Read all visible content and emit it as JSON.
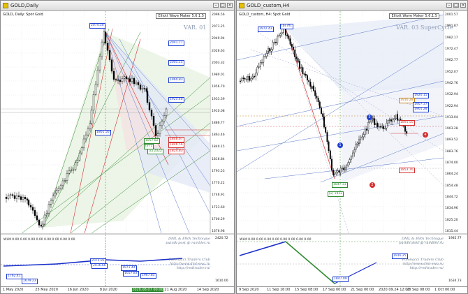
{
  "colors": {
    "blue": "#1f3fd0",
    "green": "#2e8b2e",
    "red": "#d63030",
    "gold": "#c08020",
    "grid": "#cfcfcf",
    "label_blue": "#1f3fd0",
    "label_red": "#d63030"
  },
  "windows": [
    {
      "title": "GOLD,Daily",
      "symbol": "GOLD, Daily:  Spot Gold",
      "badge": "Elliott Wave Maker 5.6.1.5",
      "variant": "VAR. 01",
      "price_labels": [
        "2096.56",
        "2073.25",
        "2049.94",
        "2026.63",
        "2003.32",
        "1980.01",
        "1956.70",
        "1933.39",
        "1910.08",
        "1886.77",
        "1863.46",
        "1840.15",
        "1816.84",
        "1793.53",
        "1770.22",
        "1746.91",
        "1723.60",
        "1700.29",
        "1676.98"
      ],
      "wlm_text": "WLM 0.00 0.00 0.00 0.00 0.00 0.00 0.00 0.00",
      "osc_labels": [
        "2420.72",
        "1610.00"
      ],
      "signature": [
        "DML & EWA Technique",
        "putnik-post @ rambler.ru",
        "Fibonacci   Traders   Club",
        "http://www.dml-ewa.ru",
        "http://redtrader.ru/"
      ],
      "x_labels": [
        "1 May 2020",
        "25 May 2020",
        "16 Jun 2020",
        "8 Jul 2020",
        "2020.08.07 00:00",
        "21 Aug 2020",
        "14 Sep 2020"
      ],
      "chart_boxes": [
        {
          "text": "2074.50",
          "color": "#1f3fd0"
        },
        {
          "text": "2041.77",
          "color": "#1f3fd0"
        },
        {
          "text": "2005.15",
          "color": "#1f3fd0"
        },
        {
          "text": "1960.83",
          "color": "#1f3fd0"
        },
        {
          "text": "1925.40",
          "color": "#1f3fd0"
        },
        {
          "text": "1861.56",
          "color": "#1f3fd0"
        },
        {
          "text": "1857.82",
          "color": "#2e8b2e"
        },
        {
          "text": "1848.67",
          "color": "#d63030"
        },
        {
          "text": "1846.56",
          "color": "#d63030"
        },
        {
          "text": "1824.83",
          "color": "#d63030"
        },
        {
          "text": "[c] 2022",
          "color": "#2e8b2e"
        },
        {
          "text": "(v) 1",
          "color": "#2e8b2e"
        }
      ],
      "osc_boxes": [
        "2070.95",
        "2016.66",
        "1762.41",
        "1679.23",
        "1971.44",
        "1657.83",
        "1967.85"
      ]
    },
    {
      "title": "GOLD_custom,H4",
      "symbol": "GOLD_custom, H4:  Spot Gold",
      "badge": "Elliott Wave Maker 5.6.1.5",
      "variant": "VAR. 03 SuperCycle",
      "price_labels": [
        "2001.57",
        "1991.87",
        "1982.17",
        "1972.47",
        "1962.77",
        "1952.07",
        "1942.76",
        "1932.94",
        "1922.94",
        "1913.04",
        "1903.28",
        "1893.52",
        "1883.76",
        "1874.00",
        "1864.24",
        "1854.48",
        "1844.72",
        "1834.96",
        "1825.20",
        "1815.44"
      ],
      "wlm_text": "WLM 0.00 0.00 0.00 0.00 0.00 0.00 0.00 0.00",
      "osc_labels": [
        "1985.77",
        "1634.73"
      ],
      "signature": [
        "DML & EWA Technique",
        "putnik-post @ rambler.ru",
        "Fibonacci   Traders   Club",
        "http://www.dml-ewa.ru",
        "http://redtrader.ru/"
      ],
      "x_labels": [
        "9 Sep 2020",
        "11 Sep 16:00",
        "15 Sep 08:00",
        "17 Sep 00:00",
        "21 Sep 00:00",
        "2020.09.24 12:00",
        "28 Sep 08:00",
        "1 Oct 00:00"
      ],
      "chart_boxes": [
        {
          "text": "1972.43",
          "color": "#1f3fd0"
        },
        {
          "text": "1920.15",
          "color": "#1f3fd0"
        },
        {
          "text": "1916.28",
          "color": "#c08020"
        },
        {
          "text": "1907.37",
          "color": "#1f3fd0"
        },
        {
          "text": "1901.28",
          "color": "#1f3fd0"
        },
        {
          "text": "1891.50",
          "color": "#d63030"
        },
        {
          "text": "1853.76",
          "color": "#d63030"
        },
        {
          "text": "1847.33",
          "color": "#2e8b2e"
        },
        {
          "text": "(b) iff1",
          "color": "#1f3fd0"
        },
        {
          "text": "[v] 1922",
          "color": "#2e8b2e"
        }
      ],
      "wave_markers": [
        {
          "text": "1",
          "color": "#1f3fd0"
        },
        {
          "text": "2",
          "color": "#d63030"
        },
        {
          "text": "3",
          "color": "#1f3fd0"
        },
        {
          "text": "4",
          "color": "#d63030"
        }
      ],
      "osc_boxes": [
        "1916.25",
        "1847.09"
      ]
    }
  ]
}
